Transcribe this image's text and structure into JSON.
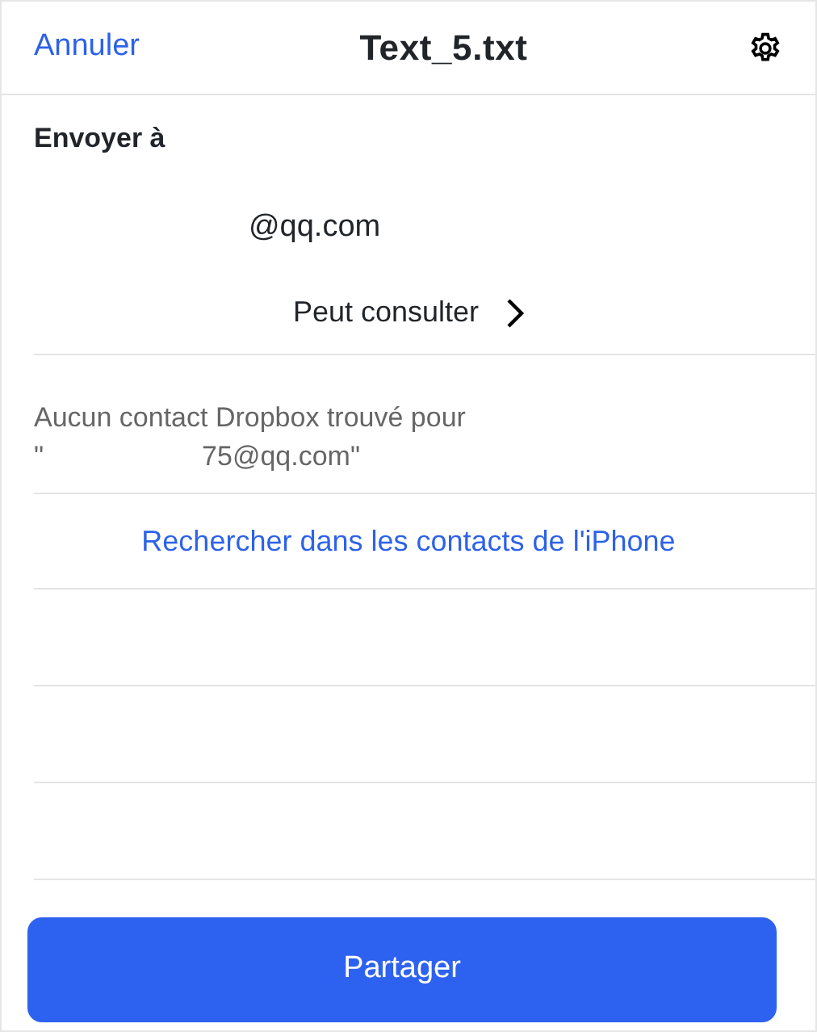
{
  "header": {
    "cancel": "Annuler",
    "title": "Text_5.txt"
  },
  "send_to": {
    "label": "Envoyer à",
    "recipient": "@qq.com",
    "permission": "Peut consulter"
  },
  "no_result": {
    "text": "Aucun contact Dropbox trouvé pour",
    "quote_open": "\"",
    "query": "75@qq.com\""
  },
  "search_link": "Rechercher dans les contacts de l'iPhone",
  "share_button": "Partager"
}
